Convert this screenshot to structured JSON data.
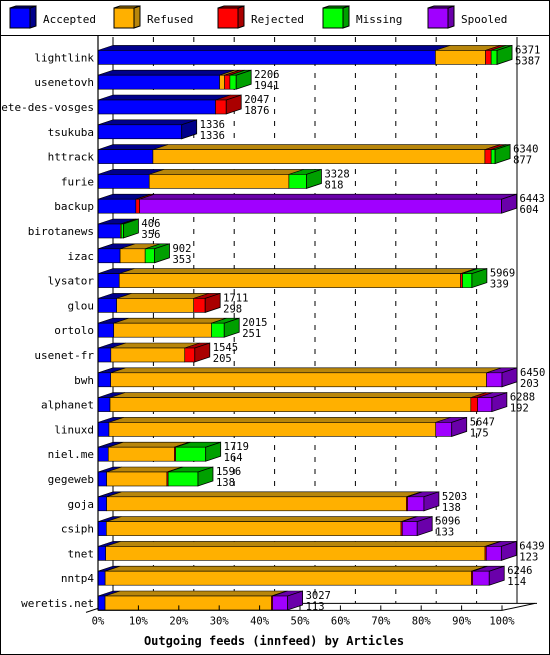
{
  "chart_data": {
    "type": "bar",
    "orientation": "horizontal",
    "stacked": true,
    "style": "3d",
    "title": "",
    "xlabel": "Outgoing feeds (innfeed) by Articles",
    "ylabel": "",
    "xlim": [
      0,
      100
    ],
    "x_ticks": [
      "0%",
      "10%",
      "20%",
      "30%",
      "40%",
      "50%",
      "60%",
      "70%",
      "80%",
      "90%",
      "100%"
    ],
    "scale_max": 6450,
    "legend_position": "top",
    "legend": [
      {
        "name": "Accepted",
        "color": "#0000ff",
        "dark": "#00008b"
      },
      {
        "name": "Refused",
        "color": "#ffb000",
        "dark": "#b8860b"
      },
      {
        "name": "Rejected",
        "color": "#ff0000",
        "dark": "#aa0000"
      },
      {
        "name": "Missing",
        "color": "#00ff00",
        "dark": "#00a000"
      },
      {
        "name": "Spooled",
        "color": "#a000ff",
        "dark": "#6a00aa"
      }
    ],
    "categories": [
      "lightlink",
      "usenetovh",
      "bete-des-vosges",
      "tsukuba",
      "httrack",
      "furie",
      "backup",
      "birotanews",
      "izac",
      "lysator",
      "glou",
      "ortolo",
      "usenet-fr",
      "bwh",
      "alphanet",
      "linuxd",
      "niel.me",
      "gegeweb",
      "goja",
      "csiph",
      "tnet",
      "nntp4",
      "weretis.net"
    ],
    "totals": [
      6371,
      2206,
      2047,
      1336,
      6340,
      3328,
      6443,
      406,
      902,
      5969,
      1711,
      2015,
      1545,
      6450,
      6288,
      5647,
      1719,
      1596,
      5203,
      5096,
      6439,
      6246,
      3027
    ],
    "accepted_labels": [
      5387,
      1941,
      1876,
      1336,
      877,
      818,
      604,
      356,
      353,
      339,
      298,
      251,
      205,
      203,
      192,
      175,
      164,
      138,
      138,
      133,
      123,
      114,
      113
    ],
    "series": [
      {
        "name": "Accepted",
        "values": [
          5387,
          1941,
          1876,
          1336,
          877,
          818,
          604,
          356,
          353,
          339,
          298,
          251,
          205,
          203,
          192,
          175,
          164,
          138,
          138,
          133,
          123,
          114,
          113
        ]
      },
      {
        "name": "Refused",
        "values": [
          800,
          80,
          0,
          0,
          5300,
          2230,
          0,
          15,
          400,
          5450,
          1230,
          1560,
          1180,
          6000,
          5760,
          5217,
          1055,
          962,
          4785,
          4705,
          6056,
          5848,
          2655
        ]
      },
      {
        "name": "Rejected",
        "values": [
          90,
          85,
          171,
          0,
          100,
          0,
          60,
          0,
          0,
          30,
          183,
          0,
          160,
          0,
          110,
          0,
          20,
          20,
          20,
          20,
          20,
          20,
          20
        ]
      },
      {
        "name": "Missing",
        "values": [
          94,
          100,
          0,
          0,
          63,
          280,
          0,
          35,
          149,
          150,
          0,
          204,
          0,
          0,
          0,
          0,
          480,
          476,
          0,
          0,
          0,
          0,
          0
        ]
      },
      {
        "name": "Spooled",
        "values": [
          0,
          0,
          0,
          0,
          0,
          0,
          5779,
          0,
          0,
          0,
          0,
          0,
          0,
          247,
          226,
          255,
          0,
          0,
          260,
          238,
          240,
          264,
          239
        ]
      }
    ]
  }
}
